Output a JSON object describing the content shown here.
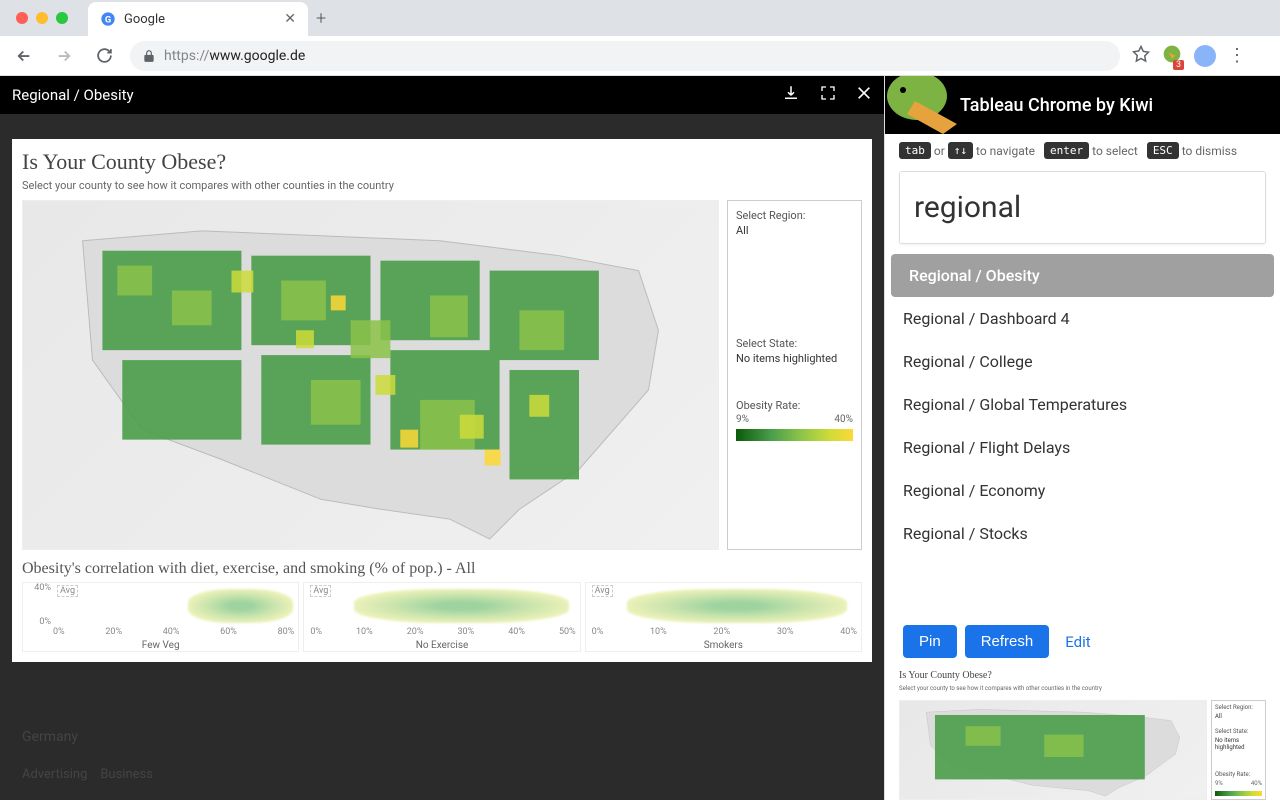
{
  "browser": {
    "tab_title": "Google",
    "url_protocol": "https://",
    "url_host": "www.google.de",
    "ext_badge": "3"
  },
  "tableau": {
    "title": "Regional / Obesity"
  },
  "viz": {
    "title": "Is Your County Obese?",
    "subtitle": "Select your county to see how it compares with other counties in the country",
    "region_label": "Select Region:",
    "region_value": "All",
    "state_label": "Select State:",
    "state_value": "No items highlighted",
    "legend_label": "Obesity Rate:",
    "legend_min": "9%",
    "legend_max": "40%",
    "scatter_title": "Obesity's correlation with diet, exercise, and smoking (% of pop.) - All",
    "y_max": "40%",
    "y_min": "0%",
    "avg": "Avg",
    "charts": {
      "fewveg": {
        "name": "Few Veg",
        "ticks": [
          "0%",
          "20%",
          "40%",
          "60%",
          "80%"
        ]
      },
      "noex": {
        "name": "No Exercise",
        "ticks": [
          "0%",
          "10%",
          "20%",
          "30%",
          "40%",
          "50%"
        ]
      },
      "smoke": {
        "name": "Smokers",
        "ticks": [
          "0%",
          "10%",
          "20%",
          "30%",
          "40%"
        ]
      }
    }
  },
  "google": {
    "country": "Germany",
    "links": {
      "adv": "Advertising",
      "biz": "Business"
    }
  },
  "ext": {
    "title": "Tableau Chrome by Kiwi",
    "hints": {
      "tab": "tab",
      "or": "or",
      "arrows": "↑↓",
      "nav": "to navigate",
      "enter": "enter",
      "select": "to select",
      "esc": "ESC",
      "dismiss": "to dismiss"
    },
    "search_value": "regional",
    "results": [
      "Regional / Obesity",
      "Regional / Dashboard 4",
      "Regional / College",
      "Regional / Global Temperatures",
      "Regional / Flight Delays",
      "Regional / Economy",
      "Regional / Stocks"
    ],
    "actions": {
      "pin": "Pin",
      "refresh": "Refresh",
      "edit": "Edit"
    }
  },
  "chart_data": {
    "type": "scatter",
    "title": "Obesity's correlation with diet, exercise, and smoking (% of pop.) - All",
    "ylabel": "Obesity Rate",
    "ylim": [
      0,
      40
    ],
    "series": [
      {
        "name": "Few Veg",
        "xlim": [
          0,
          90
        ],
        "cluster_x_range": [
          55,
          90
        ],
        "cluster_y_range": [
          8,
          40
        ]
      },
      {
        "name": "No Exercise",
        "xlim": [
          0,
          50
        ],
        "cluster_x_range": [
          10,
          48
        ],
        "cluster_y_range": [
          8,
          40
        ]
      },
      {
        "name": "Smokers",
        "xlim": [
          0,
          45
        ],
        "cluster_x_range": [
          8,
          42
        ],
        "cluster_y_range": [
          8,
          40
        ]
      }
    ],
    "color_scale": {
      "label": "Obesity Rate",
      "min": 9,
      "max": 40,
      "colors": [
        "#0a5a0a",
        "#8bc34a",
        "#fdd835"
      ]
    }
  }
}
